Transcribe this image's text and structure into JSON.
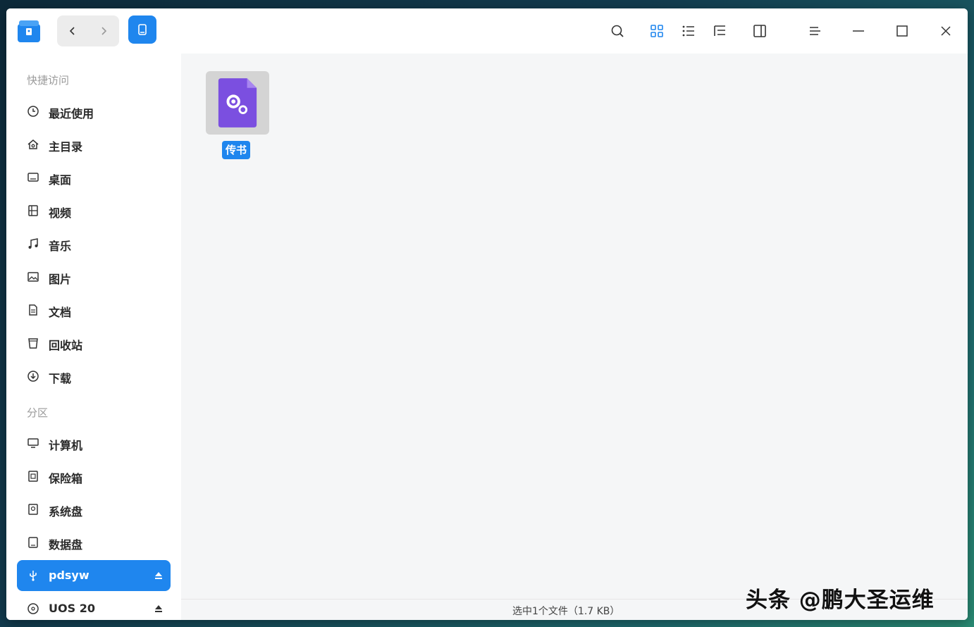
{
  "header": {
    "icons": [
      "app-logo",
      "back-icon",
      "forward-icon",
      "device-icon",
      "search-icon",
      "icon-view-icon",
      "list-view-icon",
      "tree-view-icon",
      "detail-panel-icon",
      "menu-icon",
      "minimize-icon",
      "maximize-icon",
      "close-icon"
    ],
    "active_view": "icon-view"
  },
  "sidebar": {
    "quick_access_title": "快捷访问",
    "partitions_title": "分区",
    "quick_items": [
      {
        "label": "最近使用",
        "icon": "clock-icon"
      },
      {
        "label": "主目录",
        "icon": "home-icon"
      },
      {
        "label": "桌面",
        "icon": "desktop-icon"
      },
      {
        "label": "视频",
        "icon": "video-icon"
      },
      {
        "label": "音乐",
        "icon": "music-icon"
      },
      {
        "label": "图片",
        "icon": "picture-icon"
      },
      {
        "label": "文档",
        "icon": "document-icon"
      },
      {
        "label": "回收站",
        "icon": "trash-icon"
      },
      {
        "label": "下载",
        "icon": "download-icon"
      }
    ],
    "partition_items": [
      {
        "label": "计算机",
        "icon": "computer-icon"
      },
      {
        "label": "保险箱",
        "icon": "vault-icon"
      },
      {
        "label": "系统盘",
        "icon": "system-disk-icon"
      },
      {
        "label": "数据盘",
        "icon": "data-disk-icon"
      },
      {
        "label": "pdsyw",
        "icon": "usb-icon",
        "active": true
      },
      {
        "label": "UOS 20",
        "icon": "disc-icon"
      }
    ]
  },
  "main": {
    "files": [
      {
        "name": "传书",
        "icon": "settings-file-icon",
        "selected": true
      }
    ]
  },
  "status": {
    "text": "选中1个文件（1.7 KB）"
  },
  "watermark": {
    "text": "头条 @鹏大圣运维"
  },
  "colors": {
    "accent": "#1f86ee",
    "file_icon": "#7b4fe0"
  }
}
